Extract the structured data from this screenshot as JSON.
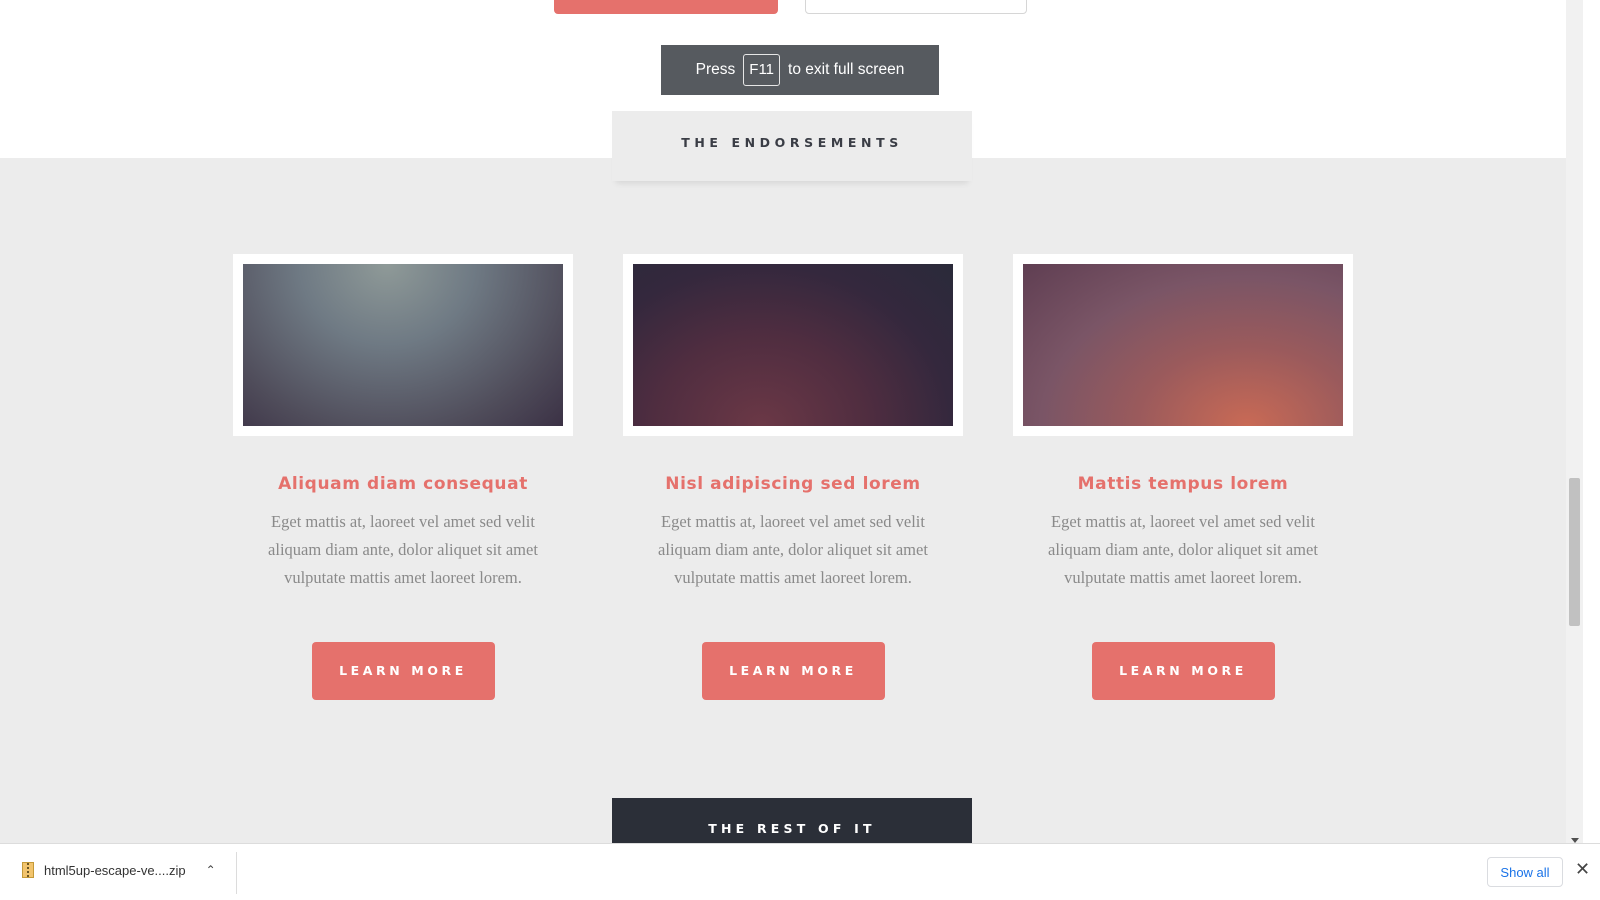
{
  "fullscreen_toast": {
    "press": "Press",
    "key": "F11",
    "rest": "to exit full screen"
  },
  "section": {
    "title": "THE ENDORSEMENTS"
  },
  "cards": [
    {
      "title": "Aliquam diam consequat",
      "text": "Eget mattis at, laoreet vel amet sed velit aliquam diam ante, dolor aliquet sit amet vulputate mattis amet laoreet lorem.",
      "button": "LEARN MORE"
    },
    {
      "title": "Nisl adipiscing sed lorem",
      "text": "Eget mattis at, laoreet vel amet sed velit aliquam diam ante, dolor aliquet sit amet vulputate mattis amet laoreet lorem.",
      "button": "LEARN MORE"
    },
    {
      "title": "Mattis tempus lorem",
      "text": "Eget mattis at, laoreet vel amet sed velit aliquam diam ante, dolor aliquet sit amet vulputate mattis amet laoreet lorem.",
      "button": "LEARN MORE"
    }
  ],
  "next_section": {
    "title": "THE REST OF IT"
  },
  "download_bar": {
    "filename": "html5up-escape-ve....zip",
    "show_all": "Show all"
  },
  "colors": {
    "accent": "#e5716c",
    "dark": "#2b2f38",
    "section_bg": "#ececec"
  },
  "icons": {
    "file": "zip-file-icon",
    "chevron": "chevron-up-icon",
    "close": "close-icon"
  }
}
